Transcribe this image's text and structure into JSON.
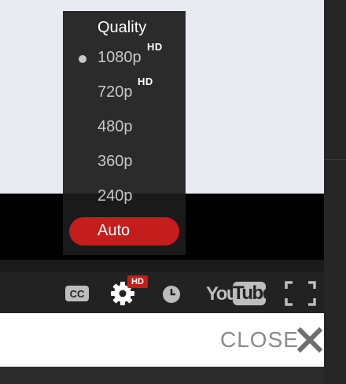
{
  "quality_menu": {
    "title": "Quality",
    "items": [
      {
        "label": "1080p",
        "hd": "HD",
        "selected": true
      },
      {
        "label": "720p",
        "hd": "HD",
        "selected": false
      },
      {
        "label": "480p",
        "hd": "",
        "selected": false
      },
      {
        "label": "360p",
        "hd": "",
        "selected": false
      },
      {
        "label": "240p",
        "hd": "",
        "selected": false
      }
    ],
    "auto_label": "Auto"
  },
  "controls": {
    "captions_icon": "cc-icon",
    "captions_text": "CC",
    "settings_icon": "gear-icon",
    "settings_badge": "HD",
    "watch_later_icon": "clock-icon",
    "logo_you": "You",
    "logo_tube": "Tube",
    "fullscreen_icon": "fullscreen-icon"
  },
  "close": {
    "label": "CLOSE",
    "icon": "close-icon"
  },
  "colors": {
    "accent": "#c51c1c",
    "menu_bg": "#1c1c1c",
    "controls_bg": "#222222",
    "video_bg": "#e8ebf0"
  }
}
